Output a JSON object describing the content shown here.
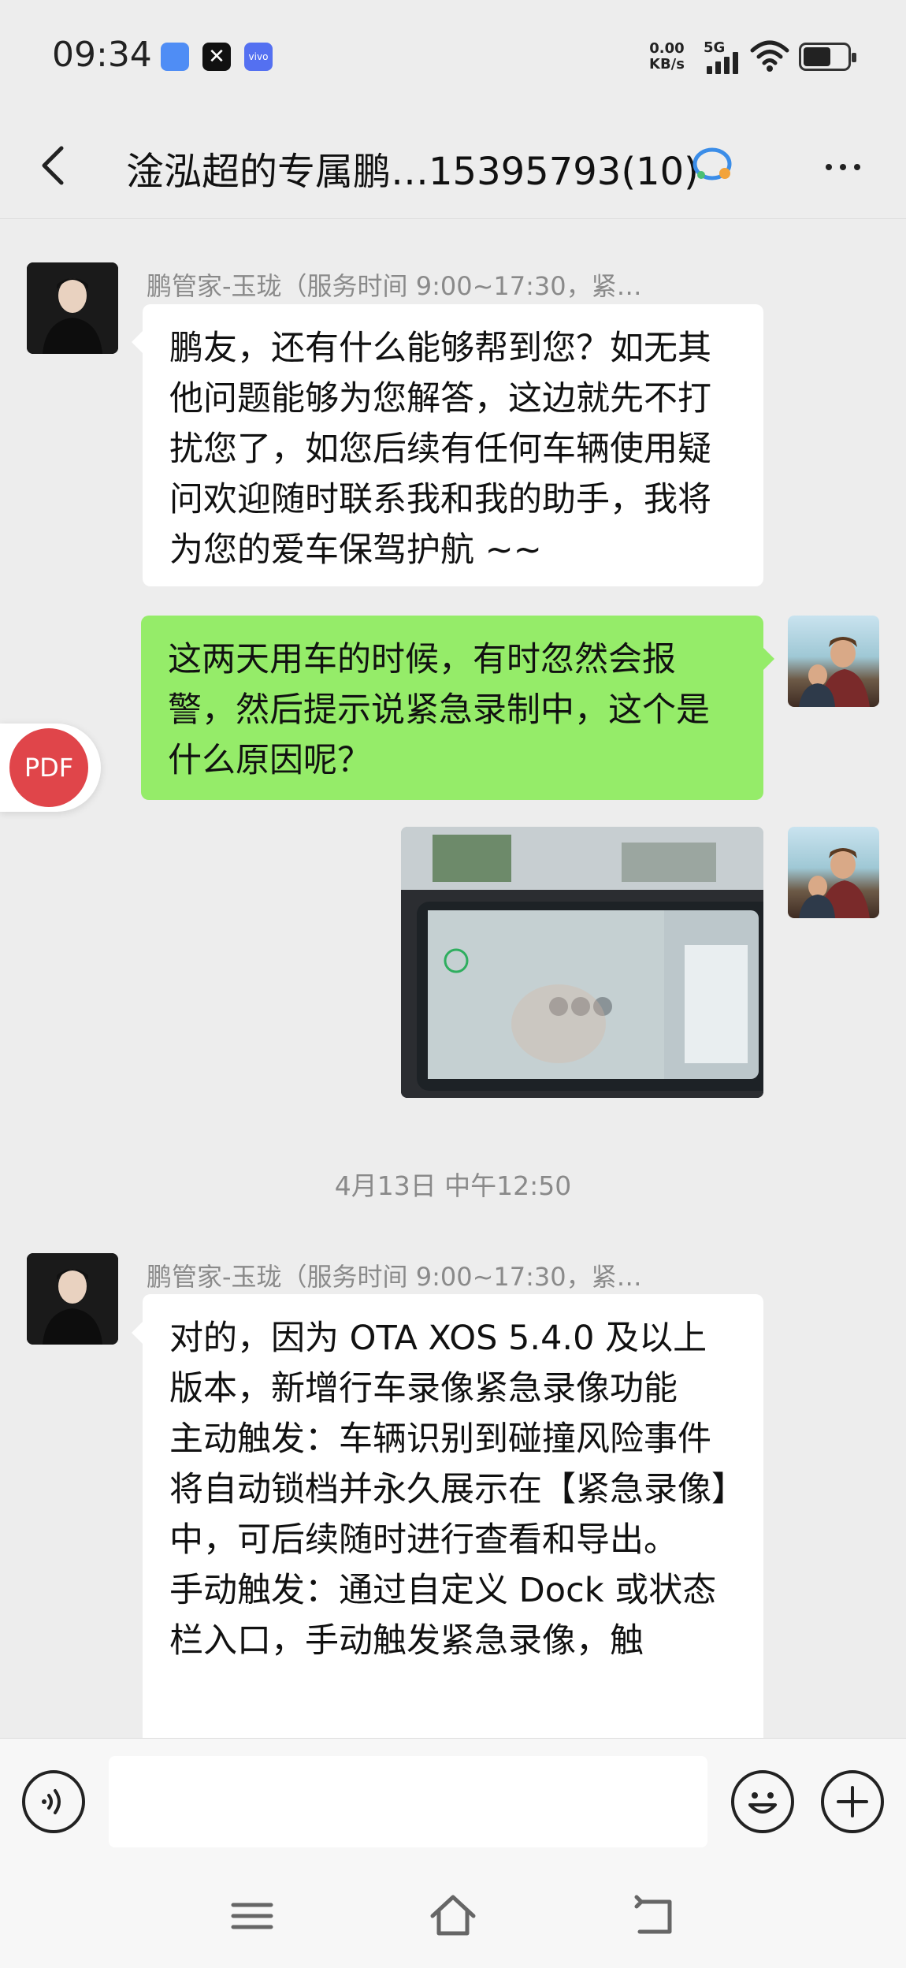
{
  "status_bar": {
    "time": "09:34",
    "app_icons": [
      "app-icon-blue",
      "app-icon-x",
      "app-icon-vivo"
    ],
    "vivo_label": "vivo",
    "net_speed_value": "0.00",
    "net_speed_unit": "KB/s",
    "network": "5G"
  },
  "header": {
    "title": "淦泓超的专属鹏…15395793(10)"
  },
  "messages": [
    {
      "sender": "鹏管家-玉珑（服务时间 9:00~17:30，紧…",
      "text": "鹏友，还有什么能够帮到您？如无其他问题能够为您解答，这边就先不打扰您了，如您后续有任何车辆使用疑问欢迎随时联系我和我的助手，我将为您的爱车保驾护航 ~~"
    },
    {
      "text": "这两天用车的时候，有时忽然会报警，然后提示说紧急录制中，这个是什么原因呢？"
    },
    {
      "timestamp": "4月13日 中午12:50"
    },
    {
      "sender": "鹏管家-玉珑（服务时间 9:00~17:30，紧…",
      "text": "对的，因为 OTA XOS 5.4.0 及以上版本，新增行车录像紧急录像功能\n主动触发：车辆识别到碰撞风险事件将自动锁档并永久展示在【紧急录像】中，可后续随时进行查看和导出。\n手动触发：通过自定义 Dock 或状态栏入口，手动触发紧急录像，触"
    }
  ],
  "pdf_button": {
    "label": "PDF"
  },
  "input": {
    "placeholder": ""
  },
  "colors": {
    "background": "#ededed",
    "bubble_self": "#95ec69",
    "bubble_other": "#ffffff",
    "pdf_red": "#e0454a"
  },
  "icons": {
    "back": "chevron-left-icon",
    "more": "more-dots-icon",
    "voice": "voice-icon",
    "emoji": "emoji-icon",
    "plus": "plus-icon",
    "nav_menu": "menu-icon",
    "nav_home": "home-icon",
    "nav_back": "back-icon"
  }
}
